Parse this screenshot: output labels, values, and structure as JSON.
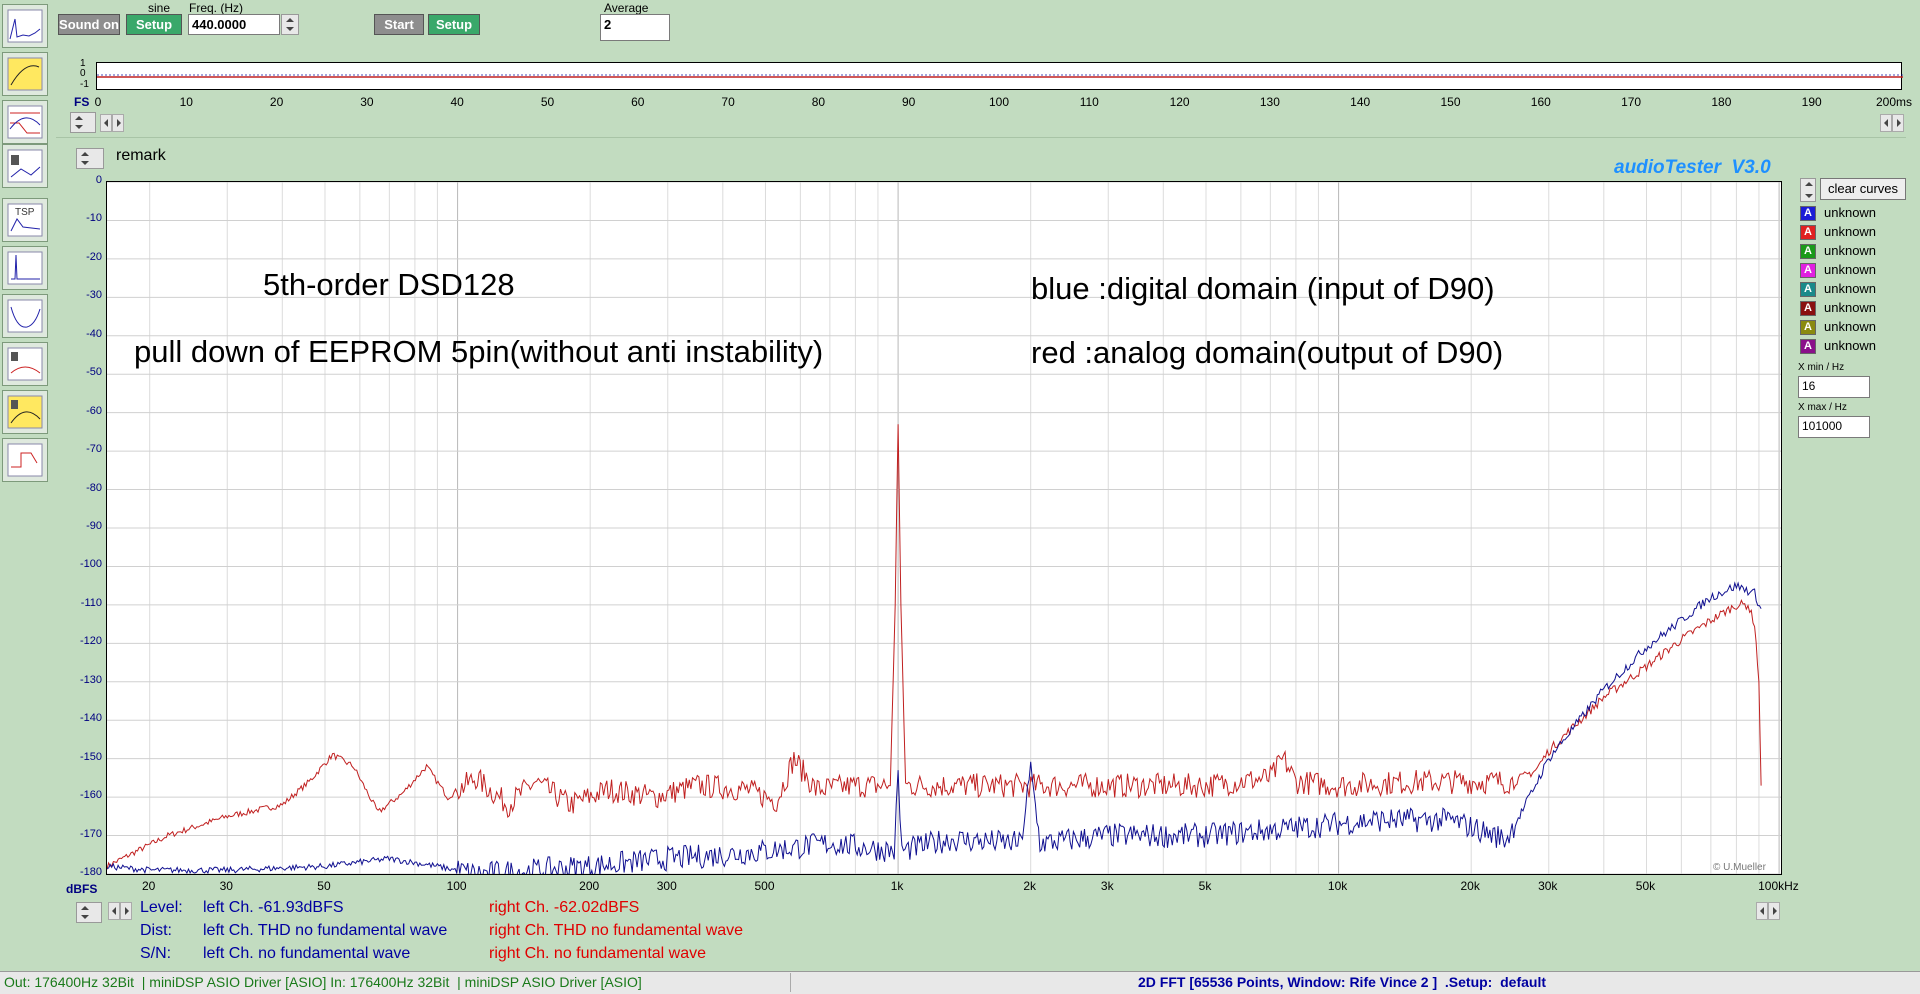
{
  "toolbar": {
    "sound_label": "Sound on",
    "setup_label": "Setup",
    "waveform_label": "sine",
    "freq_label": "Freq. (Hz)",
    "freq_value": "440.0000",
    "start_label": "Start",
    "setup2_label": "Setup",
    "average_label": "Average",
    "average_value": "2"
  },
  "scope": {
    "y_ticks": [
      "1",
      "0",
      "-1"
    ],
    "x_ticks": [
      "0",
      "10",
      "20",
      "30",
      "40",
      "50",
      "60",
      "70",
      "80",
      "90",
      "100",
      "110",
      "120",
      "130",
      "140",
      "150",
      "160",
      "170",
      "180",
      "190",
      "200ms"
    ],
    "fs_label": "FS"
  },
  "remark_label": "remark",
  "brand": "audioTester  V3.0",
  "copyright": "© U.Mueller",
  "annotations": {
    "line1": "5th-order DSD128",
    "line2": "pull down of EEPROM 5pin(without anti instability)",
    "line3": "blue :digital domain (input of D90)",
    "line4": "red :analog domain(output of D90)"
  },
  "right_panel": {
    "clear_label": "clear curves",
    "channels": [
      {
        "letter": "A",
        "name": "unknown",
        "color": "#1c1cd6"
      },
      {
        "letter": "A",
        "name": "unknown",
        "color": "#e02020"
      },
      {
        "letter": "A",
        "name": "unknown",
        "color": "#1a9a1a"
      },
      {
        "letter": "A",
        "name": "unknown",
        "color": "#e020e0"
      },
      {
        "letter": "A",
        "name": "unknown",
        "color": "#1a8a8a"
      },
      {
        "letter": "A",
        "name": "unknown",
        "color": "#8a1010"
      },
      {
        "letter": "A",
        "name": "unknown",
        "color": "#8a8a10"
      },
      {
        "letter": "A",
        "name": "unknown",
        "color": "#8a108a"
      }
    ],
    "xmin_label": "X min / Hz",
    "xmin_value": "16",
    "xmax_label": "X max / Hz",
    "xmax_value": "101000"
  },
  "chart_data": {
    "type": "line",
    "ylabel": "dBFS",
    "xlabel": "",
    "x_scale": "log",
    "xlim": [
      16,
      101000
    ],
    "ylim": [
      -180,
      0
    ],
    "y_ticks": [
      0,
      -10,
      -20,
      -30,
      -40,
      -50,
      -60,
      -70,
      -80,
      -90,
      -100,
      -110,
      -120,
      -130,
      -140,
      -150,
      -160,
      -170,
      -180
    ],
    "x_ticks": [
      {
        "v": 20,
        "l": "20"
      },
      {
        "v": 30,
        "l": "30"
      },
      {
        "v": 50,
        "l": "50"
      },
      {
        "v": 100,
        "l": "100"
      },
      {
        "v": 200,
        "l": "200"
      },
      {
        "v": 300,
        "l": "300"
      },
      {
        "v": 500,
        "l": "500"
      },
      {
        "v": 1000,
        "l": "1k"
      },
      {
        "v": 2000,
        "l": "2k"
      },
      {
        "v": 3000,
        "l": "3k"
      },
      {
        "v": 5000,
        "l": "5k"
      },
      {
        "v": 10000,
        "l": "10k"
      },
      {
        "v": 20000,
        "l": "20k"
      },
      {
        "v": 30000,
        "l": "30k"
      },
      {
        "v": 50000,
        "l": "50k"
      },
      {
        "v": 100000,
        "l": "100kHz"
      }
    ],
    "grid": true,
    "series": [
      {
        "color": "#c02020",
        "points": [
          [
            16,
            -178
          ],
          [
            18,
            -175
          ],
          [
            22,
            -170
          ],
          [
            30,
            -165
          ],
          [
            40,
            -162
          ],
          [
            46,
            -156
          ],
          [
            52,
            -149
          ],
          [
            58,
            -152
          ],
          [
            66,
            -164
          ],
          [
            75,
            -159
          ],
          [
            85,
            -152
          ],
          [
            95,
            -160
          ],
          [
            110,
            -155
          ],
          [
            130,
            -162
          ],
          [
            150,
            -156
          ],
          [
            180,
            -162
          ],
          [
            220,
            -158
          ],
          [
            280,
            -160
          ],
          [
            350,
            -157
          ],
          [
            450,
            -158
          ],
          [
            530,
            -161
          ],
          [
            580,
            -150
          ],
          [
            650,
            -158
          ],
          [
            800,
            -157
          ],
          [
            960,
            -157
          ],
          [
            985,
            -110
          ],
          [
            1000,
            -63
          ],
          [
            1015,
            -110
          ],
          [
            1040,
            -157
          ],
          [
            1300,
            -157
          ],
          [
            2000,
            -157
          ],
          [
            3000,
            -157
          ],
          [
            5000,
            -157
          ],
          [
            7000,
            -155
          ],
          [
            7500,
            -150
          ],
          [
            8000,
            -156
          ],
          [
            10000,
            -157
          ],
          [
            15000,
            -156
          ],
          [
            20000,
            -156
          ],
          [
            25000,
            -156
          ],
          [
            28000,
            -153
          ],
          [
            30000,
            -148
          ],
          [
            40000,
            -134
          ],
          [
            50000,
            -126
          ],
          [
            60000,
            -119
          ],
          [
            70000,
            -114
          ],
          [
            80000,
            -110
          ],
          [
            85000,
            -110
          ],
          [
            88000,
            -115
          ],
          [
            90000,
            -130
          ],
          [
            91000,
            -157
          ]
        ]
      },
      {
        "color": "#101090",
        "points": [
          [
            16,
            -178
          ],
          [
            20,
            -179
          ],
          [
            30,
            -179
          ],
          [
            50,
            -178
          ],
          [
            70,
            -176
          ],
          [
            90,
            -178
          ],
          [
            110,
            -180
          ],
          [
            150,
            -179
          ],
          [
            200,
            -178
          ],
          [
            300,
            -176
          ],
          [
            400,
            -175
          ],
          [
            500,
            -174
          ],
          [
            700,
            -172
          ],
          [
            980,
            -174
          ],
          [
            1000,
            -155
          ],
          [
            1020,
            -174
          ],
          [
            1300,
            -171
          ],
          [
            1900,
            -172
          ],
          [
            2000,
            -153
          ],
          [
            2100,
            -172
          ],
          [
            3000,
            -170
          ],
          [
            5000,
            -170
          ],
          [
            8000,
            -168
          ],
          [
            12000,
            -166
          ],
          [
            18000,
            -166
          ],
          [
            24000,
            -171
          ],
          [
            26000,
            -164
          ],
          [
            30000,
            -150
          ],
          [
            40000,
            -132
          ],
          [
            50000,
            -121
          ],
          [
            60000,
            -114
          ],
          [
            70000,
            -108
          ],
          [
            80000,
            -105
          ],
          [
            88000,
            -107
          ],
          [
            91000,
            -111
          ]
        ]
      }
    ]
  },
  "bottom": {
    "level_label": "Level:",
    "level_left": "left Ch. -61.93dBFS",
    "level_right": "right Ch. -62.02dBFS",
    "dist_label": "Dist:",
    "dist_left": "left Ch. THD no fundamental wave",
    "dist_right": "right Ch. THD no fundamental wave",
    "sn_label": "S/N:",
    "sn_left": "left Ch.  no fundamental wave",
    "sn_right": "right Ch.  no fundamental wave"
  },
  "status": {
    "left": "Out: 176400Hz 32Bit  | miniDSP ASIO Driver [ASIO] In: 176400Hz 32Bit  | miniDSP ASIO Driver [ASIO]",
    "right": "2D FFT [65536 Points, Window: Rife Vince 2 ]  .Setup:  default"
  },
  "colors": {
    "background": "#c2dcc0",
    "accent_blue": "#1e90ff",
    "label_blue": "#0000a0",
    "label_red": "#e00000"
  }
}
